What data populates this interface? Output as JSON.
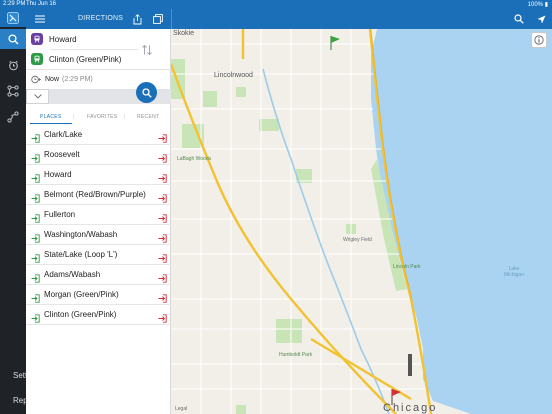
{
  "status_bar": {
    "time": "2:29 PM",
    "date": "Thu Jun 16",
    "battery": "100%"
  },
  "header": {
    "title": "DIRECTIONS"
  },
  "rail": {
    "settings_label": "Settings",
    "report_label": "Report"
  },
  "origin": {
    "label": "Howard",
    "color": "#6b3fa0"
  },
  "destination": {
    "label": "Clinton (Green/Pink)",
    "color": "#2e9a47"
  },
  "time": {
    "label": "Now",
    "detail": "(2:29 PM)"
  },
  "tabs": [
    {
      "label": "PLACES",
      "active": true
    },
    {
      "label": "FAVORITES",
      "active": false
    },
    {
      "label": "RECENT",
      "active": false
    }
  ],
  "places": [
    "Clark/Lake",
    "Roosevelt",
    "Howard",
    "Belmont (Red/Brown/Purple)",
    "Fullerton",
    "Washington/Wabash",
    "State/Lake (Loop 'L')",
    "Adams/Wabash",
    "Morgan (Green/Pink)",
    "Clinton (Green/Pink)"
  ],
  "map": {
    "city": "Chicago",
    "labels": {
      "skokie": "Skokie",
      "lincolnwood": "Lincolnwood",
      "lake": "Lake Michigan",
      "lincoln_park": "Lincoln Park",
      "humboldt_park": "Humboldt Park",
      "labagh": "LaBagh Woods",
      "wrigley": "Wrigley Field",
      "legal": "Legal"
    },
    "colors": {
      "water": "#a9d3f0",
      "land": "#f2efe9",
      "park": "#c9e5b8",
      "highway": "#f2c230"
    }
  },
  "colors": {
    "accent": "#1a6fb8",
    "enter_icon": "#2e9a47",
    "exit_icon": "#d0303a"
  }
}
